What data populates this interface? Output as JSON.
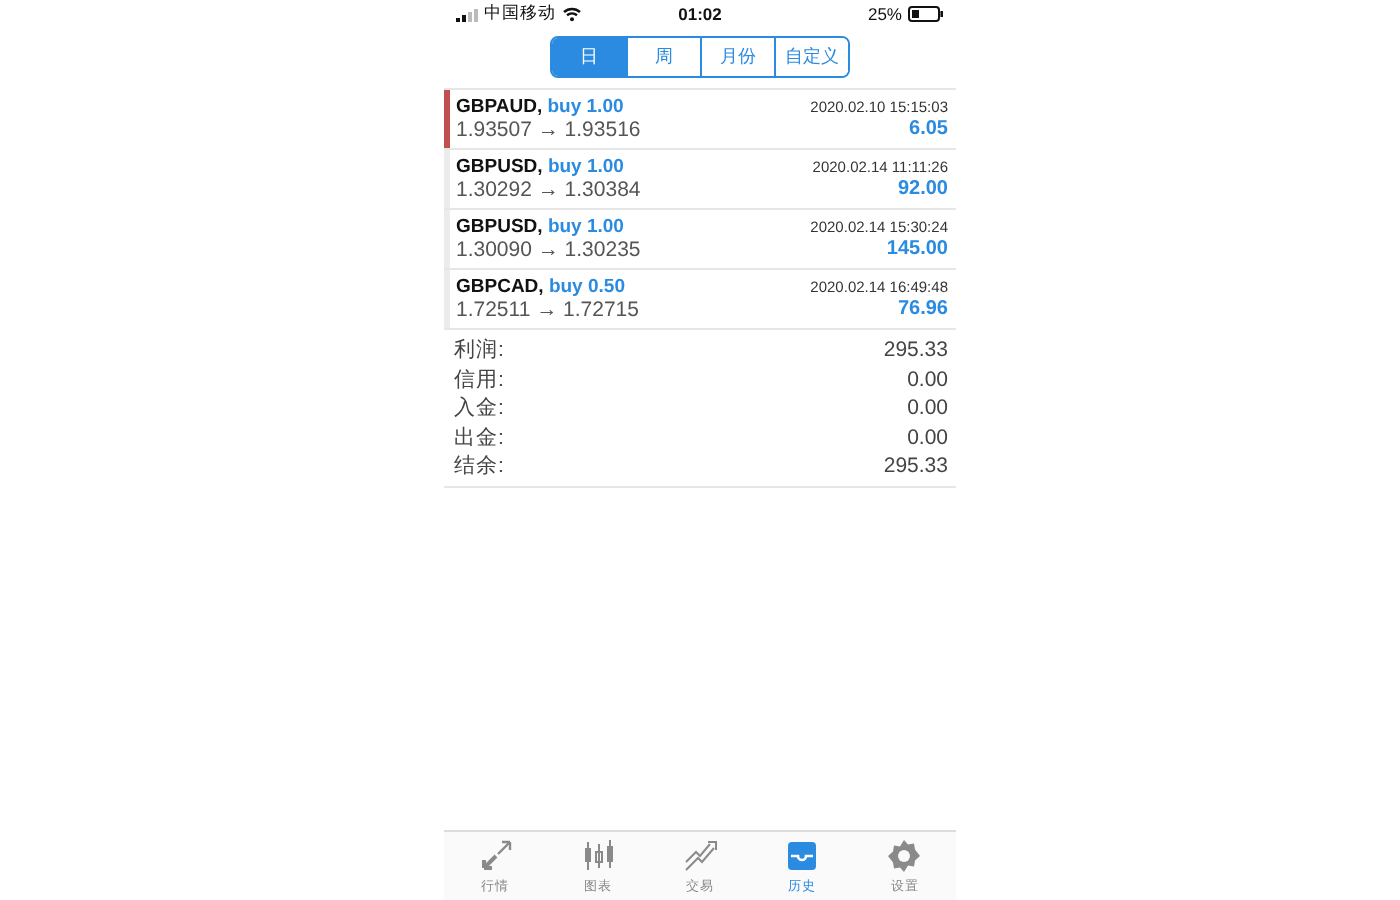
{
  "status_bar": {
    "carrier": "中国移动",
    "time": "01:02",
    "battery": "25%"
  },
  "periods": [
    {
      "label": "日",
      "selected": true
    },
    {
      "label": "周",
      "selected": false
    },
    {
      "label": "月份",
      "selected": false
    },
    {
      "label": "自定义",
      "selected": false
    }
  ],
  "trades": [
    {
      "symbol": "GBPAUD,",
      "action": "buy 1.00",
      "time": "2020.02.10 15:15:03",
      "prices": "1.93507 → 1.93516",
      "profit": "6.05",
      "selected": true
    },
    {
      "symbol": "GBPUSD,",
      "action": "buy 1.00",
      "time": "2020.02.14 11:11:26",
      "prices": "1.30292 → 1.30384",
      "profit": "92.00",
      "selected": false
    },
    {
      "symbol": "GBPUSD,",
      "action": "buy 1.00",
      "time": "2020.02.14 15:30:24",
      "prices": "1.30090 → 1.30235",
      "profit": "145.00",
      "selected": false
    },
    {
      "symbol": "GBPCAD,",
      "action": "buy 0.50",
      "time": "2020.02.14 16:49:48",
      "prices": "1.72511 → 1.72715",
      "profit": "76.96",
      "selected": false
    }
  ],
  "summary": [
    {
      "label": "利润:",
      "value": "295.33"
    },
    {
      "label": "信用:",
      "value": "0.00"
    },
    {
      "label": "入金:",
      "value": "0.00"
    },
    {
      "label": "出金:",
      "value": "0.00"
    },
    {
      "label": "结余:",
      "value": "295.33"
    }
  ],
  "tab_bar": [
    {
      "label": "行情",
      "kind": "quotes",
      "selected": false
    },
    {
      "label": "图表",
      "kind": "chart",
      "selected": false
    },
    {
      "label": "交易",
      "kind": "trade",
      "selected": false
    },
    {
      "label": "历史",
      "kind": "history",
      "selected": true
    },
    {
      "label": "设置",
      "kind": "settings",
      "selected": false
    }
  ]
}
